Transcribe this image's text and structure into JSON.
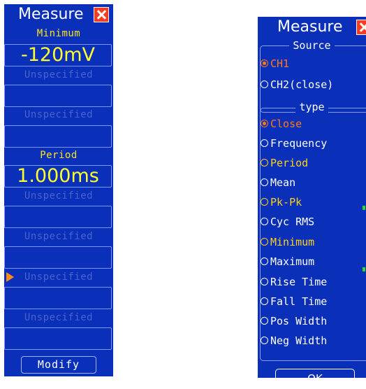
{
  "left": {
    "title": "Measure",
    "slots": [
      {
        "label": "Minimum",
        "value": "-120mV",
        "active": true
      },
      {
        "label": "Unspecified",
        "value": "",
        "active": false
      },
      {
        "label": "Unspecified",
        "value": "",
        "active": false
      },
      {
        "label": "Period",
        "value": "1.000ms",
        "active": true
      },
      {
        "label": "Unspecified",
        "value": "",
        "active": false
      },
      {
        "label": "Unspecified",
        "value": "",
        "active": false
      },
      {
        "label": "Unspecified",
        "value": "",
        "active": false,
        "pointer": true
      },
      {
        "label": "Unspecified",
        "value": "",
        "active": false
      }
    ],
    "modify_label": "Modify"
  },
  "right": {
    "title": "Measure",
    "source_title": "Source",
    "sources": [
      {
        "label": "CH1",
        "selected": true,
        "color": "orange"
      },
      {
        "label": "CH2(close)",
        "selected": false,
        "color": "white"
      }
    ],
    "type_title": "type",
    "types": [
      {
        "label": "Close",
        "selected": true,
        "color": "orange"
      },
      {
        "label": "Frequency",
        "selected": false,
        "color": "white"
      },
      {
        "label": "Period",
        "selected": false,
        "color": "yellow"
      },
      {
        "label": "Mean",
        "selected": false,
        "color": "white"
      },
      {
        "label": "Pk-Pk",
        "selected": false,
        "color": "yellow"
      },
      {
        "label": "Cyc RMS",
        "selected": false,
        "color": "white"
      },
      {
        "label": "Minimum",
        "selected": false,
        "color": "yellow"
      },
      {
        "label": "Maximum",
        "selected": false,
        "color": "white"
      },
      {
        "label": "Rise Time",
        "selected": false,
        "color": "white"
      },
      {
        "label": "Fall Time",
        "selected": false,
        "color": "white"
      },
      {
        "label": "Pos Width",
        "selected": false,
        "color": "white"
      },
      {
        "label": "Neg Width",
        "selected": false,
        "color": "white"
      }
    ],
    "ok_label": "OK"
  },
  "colors": {
    "panel_bg": "#0a2fb8",
    "value_yellow": "#ffff2e",
    "selected_orange": "#ff7a1a",
    "close_red": "#ff3b1f"
  }
}
